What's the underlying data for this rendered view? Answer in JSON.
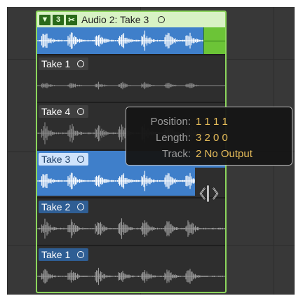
{
  "take_folder": {
    "header_buttons": [
      "▼",
      "3",
      "✂"
    ],
    "title": "Audio 2: Take 3"
  },
  "takes": [
    {
      "label": "Take 1",
      "state": "dim"
    },
    {
      "label": "Take 4",
      "state": "dim"
    },
    {
      "label": "Take 3",
      "state": "active"
    },
    {
      "label": "Take 2",
      "state": "dim"
    },
    {
      "label": "Take 1",
      "state": "dim"
    }
  ],
  "tooltip": {
    "position_label": "Position:",
    "position_value": "1 1 1 1",
    "length_label": "Length:",
    "length_value": "3 2 0 0",
    "track_label": "Track:",
    "track_value": "2  No Output"
  },
  "icons": {
    "collapse": "triangle-down-icon",
    "take_count": "take-count-badge",
    "quick_swipe": "scissors-icon",
    "take_menu": "circle-menu-icon",
    "cursor": "trim-resize-cursor-icon"
  },
  "colors": {
    "folder_border": "#8cd65c",
    "folder_header": "#d8f2c4",
    "comp_region": "#3f7fca",
    "comp_green": "#6cc437",
    "tooltip_value": "#e7bd5a",
    "tooltip_label": "#9a9a9a"
  }
}
